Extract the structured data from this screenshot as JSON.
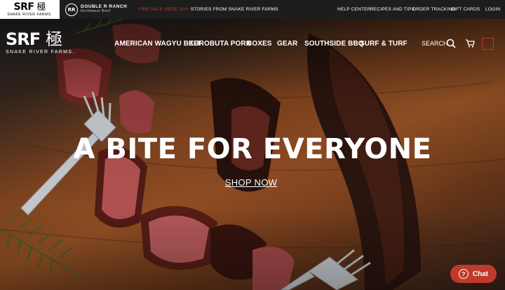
{
  "topbar": {
    "srf_letters": "SRF",
    "srf_kanji": "極",
    "srf_sub": "SNAKE RIVER FARMS.",
    "drr_badge": "RR",
    "drr_name": "DOUBLE R RANCH",
    "drr_sub": "Northwest Beef",
    "promo": "FIRE SALE HERE 20%",
    "promo_link": "STORIES FROM SNAKE RIVER FARMS",
    "links": {
      "help": "HELP CENTER",
      "recipes": "RECIPES AND TIPS",
      "tracking": "ORDER TRACKING",
      "giftcards": "GIFT CARDS",
      "login": "LOGIN"
    }
  },
  "nav": {
    "logo_letters": "SRF",
    "logo_kanji": "極",
    "logo_sub": "SNAKE RIVER FARMS.",
    "items": {
      "wagyu": "AMERICAN WAGYU BEEF",
      "kurobuta": "KUROBUTA PORK",
      "boxes": "BOXES",
      "gear": "GEAR",
      "bbq": "SOUTHSIDE BBQ",
      "surf": "SURF & TURF"
    },
    "search_label": "SEARCH"
  },
  "hero": {
    "title": "A BITE FOR EVERYONE",
    "cta": "SHOP NOW"
  },
  "chat": {
    "label": "Chat",
    "icon": "?"
  },
  "colors": {
    "accent": "#c0392b",
    "topbar": "#1d1d1d"
  }
}
